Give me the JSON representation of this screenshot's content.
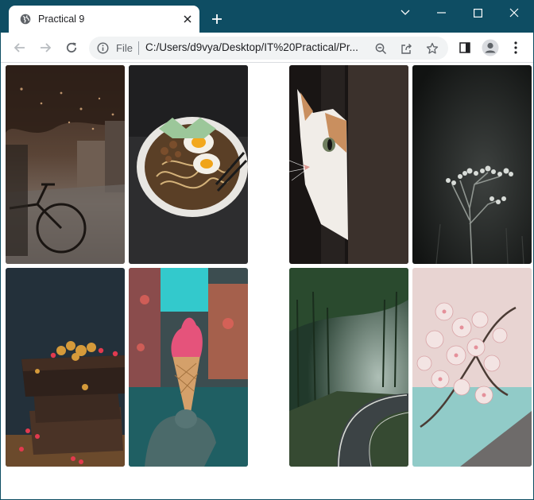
{
  "window": {
    "tab_title": "Practical 9",
    "frame_color": "#0e4d63"
  },
  "toolbar": {
    "scheme_label": "File",
    "url": "C:/Users/d9vya/Desktop/IT%20Practical/Pr..."
  },
  "icons": {
    "favicon": "globe-icon",
    "tab_close": "close-icon",
    "new_tab": "plus-icon",
    "back": "back-arrow-icon",
    "forward": "forward-arrow-icon",
    "reload": "reload-icon",
    "site_info": "info-icon",
    "zoom": "zoom-icon",
    "share": "share-icon",
    "bookmark": "star-icon",
    "side_panel": "side-panel-icon",
    "profile": "profile-icon",
    "menu": "kebab-menu-icon"
  },
  "gallery": {
    "photos": [
      {
        "subject": "street-bicycle"
      },
      {
        "subject": "ramen-bowl"
      },
      {
        "subject": "cat-peeking"
      },
      {
        "subject": "wildflower"
      },
      {
        "subject": "chocolate-brownies"
      },
      {
        "subject": "ice-cream-cone"
      },
      {
        "subject": "forest-road"
      },
      {
        "subject": "cherry-blossom"
      }
    ]
  }
}
